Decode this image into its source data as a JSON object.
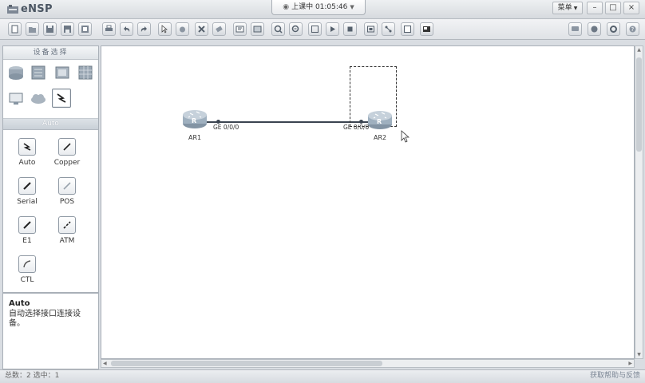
{
  "app": {
    "title": "eNSP"
  },
  "session": {
    "label": "上课中 01:05:46"
  },
  "window": {
    "menu_label": "菜单",
    "minimize": "–",
    "maximize": "□",
    "close": "×"
  },
  "toolbar": {
    "buttons": [
      "new-topology",
      "open",
      "save",
      "save-as",
      "print",
      "undo",
      "redo",
      "select",
      "pan",
      "delete",
      "delete-all",
      "text-note",
      "shape",
      "zoom-in",
      "zoom-out",
      "fit",
      "start-device",
      "stop-device",
      "capture",
      "topology-layout",
      "snapshot",
      "screenshot"
    ],
    "right_buttons": [
      "chat",
      "forum",
      "settings",
      "help"
    ]
  },
  "left_panel": {
    "title": "设备选择",
    "categories": [
      "router",
      "switch",
      "wlan",
      "firewall",
      "terminal",
      "cloud",
      "connection"
    ],
    "selected_category": "connection",
    "subheader": "Auto",
    "cables": [
      {
        "id": "auto",
        "label": "Auto"
      },
      {
        "id": "copper",
        "label": "Copper"
      },
      {
        "id": "serial",
        "label": "Serial"
      },
      {
        "id": "pos",
        "label": "POS"
      },
      {
        "id": "e1",
        "label": "E1"
      },
      {
        "id": "atm",
        "label": "ATM"
      },
      {
        "id": "ctl",
        "label": "CTL"
      }
    ],
    "description": {
      "title": "Auto",
      "text": "自动选择接口连接设备。"
    }
  },
  "canvas": {
    "devices": [
      {
        "name": "AR1",
        "port": "GE 0/0/0"
      },
      {
        "name": "AR2",
        "port": "GE 0/0/0"
      }
    ],
    "link_type": "Copper"
  },
  "status": {
    "left": "总数：2  选中：1",
    "right": "获取帮助与反馈"
  },
  "colors": {
    "link": "#3b4450",
    "router_body": "#9fb0bf",
    "accent": "#4b5663"
  }
}
